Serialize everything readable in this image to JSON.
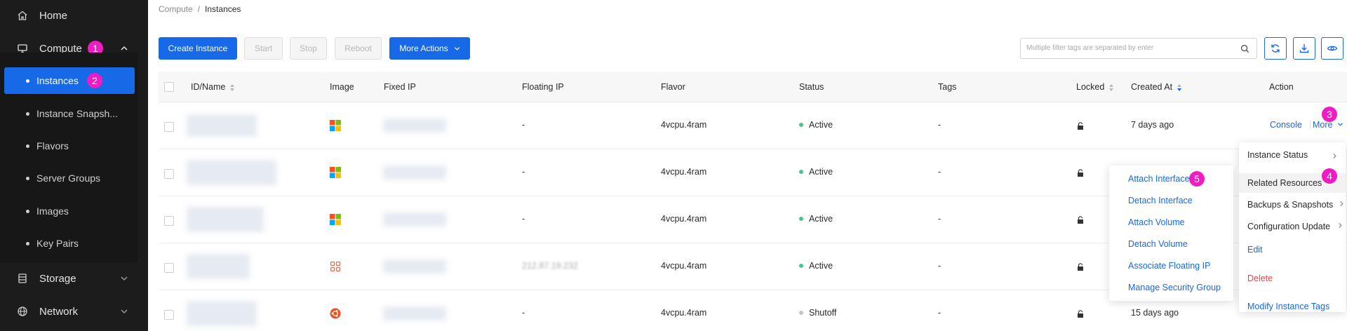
{
  "sidebar": {
    "home": "Home",
    "compute": "Compute",
    "sub_items": [
      "Instances",
      "Instance Snapsh...",
      "Flavors",
      "Server Groups",
      "Images",
      "Key Pairs"
    ],
    "storage": "Storage",
    "network": "Network"
  },
  "steps": [
    "1",
    "2",
    "3",
    "4",
    "5"
  ],
  "breadcrumb": {
    "parent": "Compute",
    "separator": "/",
    "current": "Instances"
  },
  "toolbar": {
    "create": "Create Instance",
    "start": "Start",
    "stop": "Stop",
    "reboot": "Reboot",
    "more_actions": "More Actions",
    "search_placeholder": "Multiple filter tags are separated by enter"
  },
  "table": {
    "columns": [
      "ID/Name",
      "Image",
      "Fixed IP",
      "Floating IP",
      "Flavor",
      "Status",
      "Tags",
      "Locked",
      "Created At",
      "Action"
    ],
    "rows": [
      {
        "floating_ip": "-",
        "flavor": "4vcpu.4ram",
        "status": "Active",
        "tags": "-",
        "created": "7 days ago"
      },
      {
        "floating_ip": "-",
        "flavor": "4vcpu.4ram",
        "status": "Active",
        "tags": "-",
        "created": ""
      },
      {
        "floating_ip": "-",
        "flavor": "4vcpu.4ram",
        "status": "Active",
        "tags": "-",
        "created": ""
      },
      {
        "floating_ip": "212.87.19.232",
        "flavor": "4vcpu.4ram",
        "status": "Active",
        "tags": "-",
        "created": ""
      },
      {
        "floating_ip": "-",
        "flavor": "4vcpu.4ram",
        "status": "Shutoff",
        "tags": "-",
        "created": "15 days ago"
      }
    ],
    "action_console": "Console",
    "action_more": "More"
  },
  "more_menu": [
    "Instance Status",
    "Related Resources",
    "Backups & Snapshots",
    "Configuration Update",
    "Edit",
    "Delete",
    "Modify Instance Tags"
  ],
  "related_menu": [
    "Attach Interface",
    "Detach Interface",
    "Attach Volume",
    "Detach Volume",
    "Associate Floating IP",
    "Manage Security Group"
  ],
  "colors": {
    "primary": "#1769e8",
    "sidebar_bg": "#1c1c1c",
    "badge": "#ee1cc3",
    "active": "#4cc38a",
    "shutoff": "#c4c4c4",
    "danger": "#e5484d"
  }
}
